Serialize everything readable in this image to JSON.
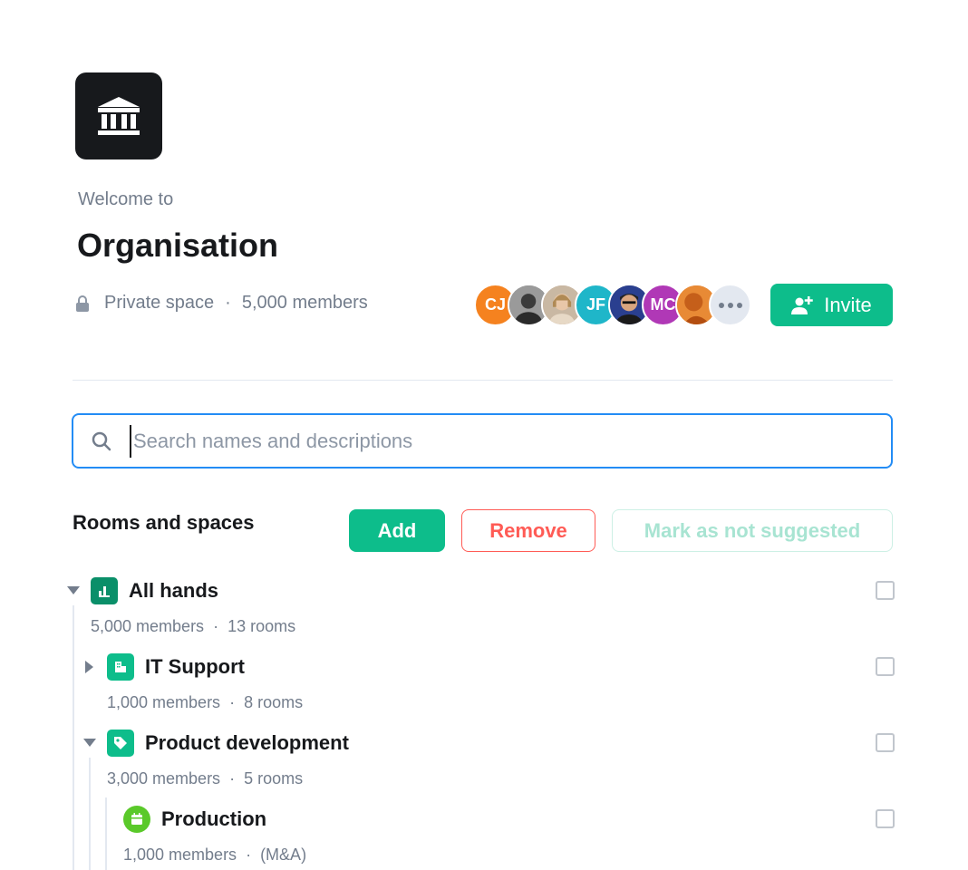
{
  "space": {
    "welcome": "Welcome to",
    "name": "Organisation",
    "privacy": "Private space",
    "members": "5,000 members"
  },
  "avatars": [
    {
      "initials": "CJ",
      "color": "#f5821f"
    },
    {
      "initials": "",
      "color": "#6f6f6f"
    },
    {
      "initials": "",
      "color": "#b98f6e"
    },
    {
      "initials": "JF",
      "color": "#1fb6c9"
    },
    {
      "initials": "",
      "color": "#2d3a6b"
    },
    {
      "initials": "MC",
      "color": "#b038b6"
    },
    {
      "initials": "",
      "color": "#e07a28"
    }
  ],
  "invite_label": "Invite",
  "search": {
    "placeholder": "Search names and descriptions"
  },
  "rooms_section": {
    "title": "Rooms and spaces",
    "add_label": "Add",
    "remove_label": "Remove",
    "mark_label": "Mark as not suggested"
  },
  "tree": [
    {
      "name": "All hands",
      "members": "5,000 members",
      "detail": "13 rooms",
      "icon": "chart-icon",
      "color": "#0a8f69",
      "expanded": true
    },
    {
      "name": "IT Support",
      "members": "1,000 members",
      "detail": "8 rooms",
      "icon": "building-icon",
      "color": "#0dbd8b",
      "expanded": false
    },
    {
      "name": "Product development",
      "members": "3,000 members",
      "detail": "5 rooms",
      "icon": "tag-icon",
      "color": "#0dbd8b",
      "expanded": true
    },
    {
      "name": "Production",
      "members": "1,000 members",
      "detail": "(M&A)",
      "icon": "calendar-icon",
      "color": "#5ac92a"
    }
  ],
  "colors": {
    "accent": "#0dbd8b",
    "danger": "#ff5b55",
    "focus": "#238cf5",
    "muted": "#737d8c"
  }
}
